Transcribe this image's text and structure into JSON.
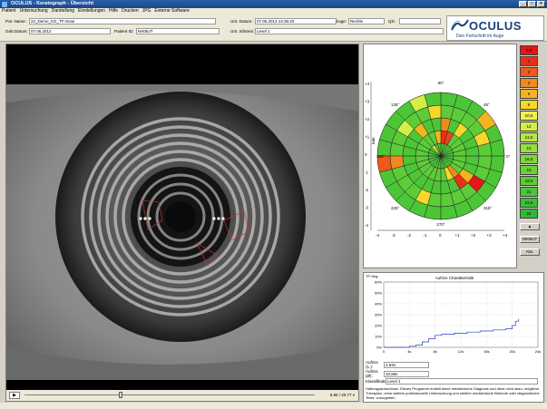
{
  "window": {
    "title": "OCULUS - Keratograph - Übersicht",
    "buttons": [
      "_",
      "□",
      "×"
    ]
  },
  "menu": [
    "Patient",
    "Untersuchung",
    "Darstellung",
    "Einstellungen",
    "Hilfe",
    "Drucken",
    "JPG",
    "Externe Software"
  ],
  "patient": {
    "name_label": "Pat. Name:",
    "name": "22_Demo_KG_TF-Scan",
    "dob_label": "Geb.Datum:",
    "dob": "07.06.2012",
    "id_label": "Patient ID:",
    "id": "NIKBUT"
  },
  "exam": {
    "date_label": "Unt. Datum:",
    "date": "07.06.2012 14:36:22",
    "eye_label": "Auge:",
    "eye": "Rechts",
    "qs_label": "QS:",
    "qs": "",
    "level_label": "Unt. Infotext:",
    "level": "Level 1"
  },
  "logo": {
    "brand": "OCULUS",
    "slogan": "Den Fortschritt im Auge"
  },
  "video": {
    "play": "▶",
    "timecode": "5.86 / 20.77 s",
    "progress": 0.33
  },
  "map": {
    "axis_top": "90°",
    "axis_bottom": "270°",
    "axis_left": "180°",
    "axis_right": "0°",
    "diag_labels": [
      "135°",
      "45°",
      "225°",
      "315°"
    ],
    "y_ticks": [
      "+4",
      "+3",
      "+2",
      "+1",
      "0",
      "-1",
      "-2",
      "-3",
      "-4"
    ],
    "x_ticks": [
      "-4",
      "-3",
      "-2",
      "-1",
      "0",
      "+1",
      "+2",
      "+3",
      "+4"
    ],
    "ylabel": "mm"
  },
  "scale": {
    "values": [
      "0,5",
      "1",
      "2",
      "3",
      "6",
      "8",
      "10,5",
      "12",
      "13,5",
      "15",
      "16,5",
      "18",
      "19,5",
      "21",
      "22,5",
      "24"
    ],
    "colors": [
      "#e41616",
      "#e83018",
      "#ee5a1a",
      "#f08a1c",
      "#f4b420",
      "#f6d82a",
      "#f0f050",
      "#d4ee48",
      "#b4e844",
      "#94e040",
      "#7cd83c",
      "#6cd23a",
      "#5ccc38",
      "#4cc636",
      "#3cc034",
      "#2cba32"
    ],
    "buttons": [
      "▲",
      "NIKBUT",
      "Abs."
    ]
  },
  "chart_data": {
    "type": "line",
    "title": "Aufriss Charakteristik",
    "ylabel": "TF-Seg.",
    "y_ticks": [
      "0%",
      "10%",
      "20%",
      "30%",
      "40%",
      "50%",
      "60%"
    ],
    "x_ticks": [
      "0",
      "4s",
      "8s",
      "12s",
      "16s",
      "20s",
      "24s"
    ],
    "ylim": [
      0,
      60
    ],
    "xlim": [
      0,
      24
    ],
    "x": [
      0,
      1,
      2,
      3,
      4,
      5,
      6,
      7,
      8,
      9,
      10,
      11,
      12,
      13,
      14,
      15,
      16,
      17,
      18,
      19,
      20,
      20.5,
      21
    ],
    "y": [
      0,
      0,
      0,
      0,
      1,
      2,
      5,
      8,
      11,
      12,
      12,
      13,
      13,
      14,
      14,
      15,
      15,
      16,
      16,
      17,
      20,
      24,
      26
    ]
  },
  "results": {
    "first_label": "Aufriss (1.):",
    "first": "2,64s",
    "avg_label": "Aufriss (Ø):",
    "avg": "10,86s",
    "class_label": "Klassifikation:",
    "class": "Level 1"
  },
  "disclaimer": "Haftungsausschluss: Dieses Programm erstellt keine medizinische Diagnose und dient nicht dazu, mögliche Therapien, ohne weitere professionelle Untersuchung und weitere medizinische Befunde oder diagnostische Tests, vorzugeben."
}
